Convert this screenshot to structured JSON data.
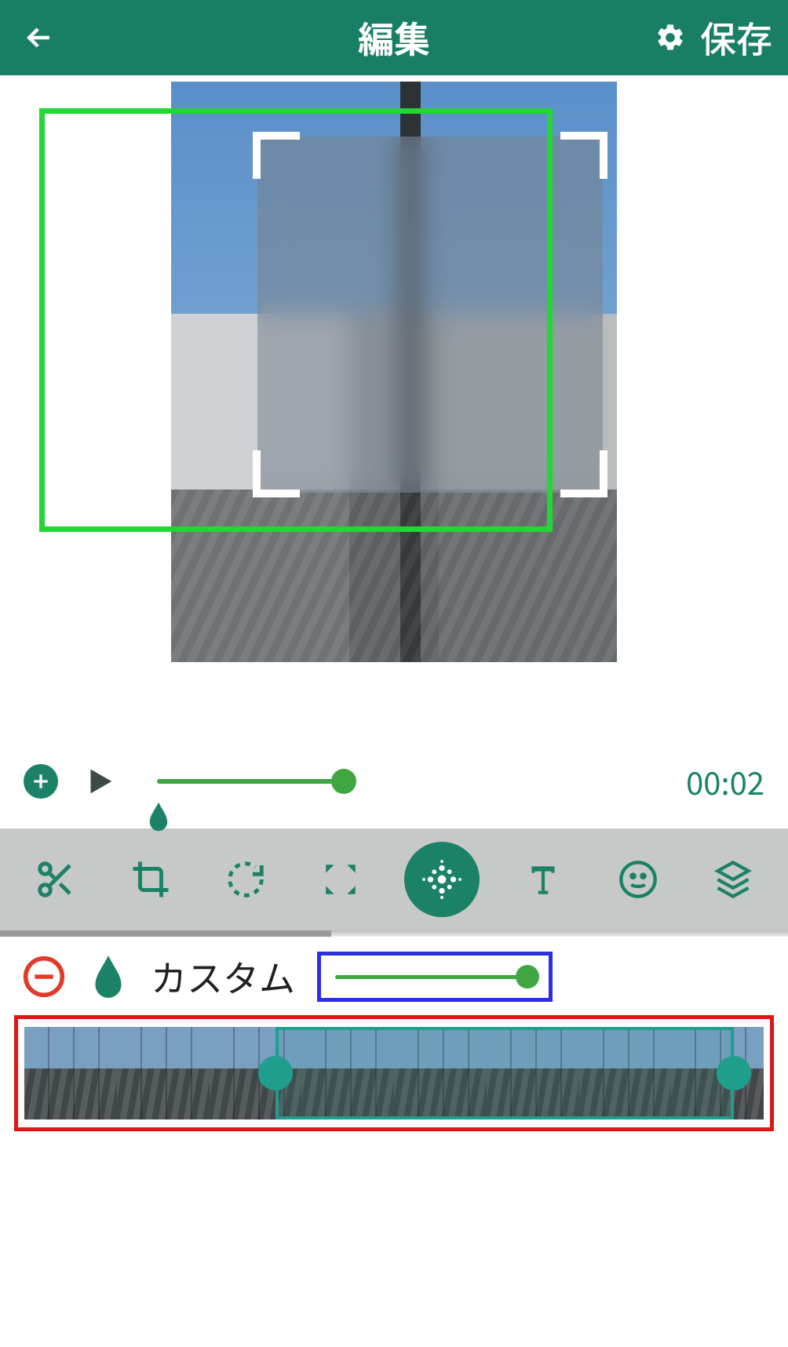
{
  "header": {
    "title": "編集",
    "save_label": "保存"
  },
  "playback": {
    "time": "00:02"
  },
  "custom": {
    "label": "カスタム"
  },
  "colors": {
    "primary": "#187f65",
    "accent_green": "#3fa641",
    "highlight_green": "#22d634",
    "highlight_blue": "#2a2fe0",
    "highlight_red": "#e01616",
    "teal": "#1f9e8e"
  },
  "tools": [
    {
      "name": "cut"
    },
    {
      "name": "crop"
    },
    {
      "name": "rotate"
    },
    {
      "name": "expand"
    },
    {
      "name": "blur",
      "active": true
    },
    {
      "name": "text"
    },
    {
      "name": "emoji"
    },
    {
      "name": "layers"
    }
  ]
}
